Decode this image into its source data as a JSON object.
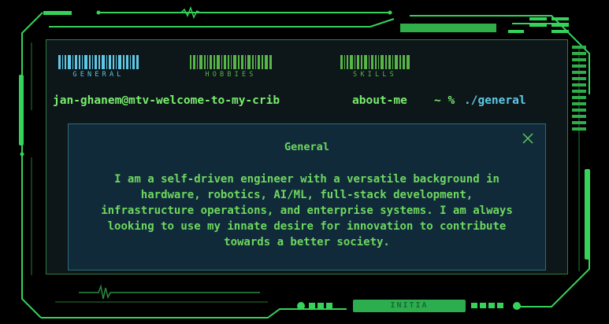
{
  "tabs": [
    {
      "label": "GENERAL"
    },
    {
      "label": "HOBBIES"
    },
    {
      "label": "SKILLS"
    }
  ],
  "prompt": {
    "user": "jan-ghanem@mtv-welcome-to-my-crib",
    "dir": "about-me",
    "symbol": "~ %",
    "command": "./general"
  },
  "dialog": {
    "title": "General",
    "body": "I am a self-driven engineer with a versatile background in hardware, robotics, AI/ML, full-stack development, infrastructure operations, and enterprise systems. I am always looking to use my innate desire for innovation to contribute towards a better society."
  },
  "footer": {
    "button_label": "INITIA"
  },
  "colors": {
    "accent": "#3fe06a",
    "panel": "#112a3a",
    "text": "#6ed75f",
    "tab_active": "#5fc8e6"
  }
}
